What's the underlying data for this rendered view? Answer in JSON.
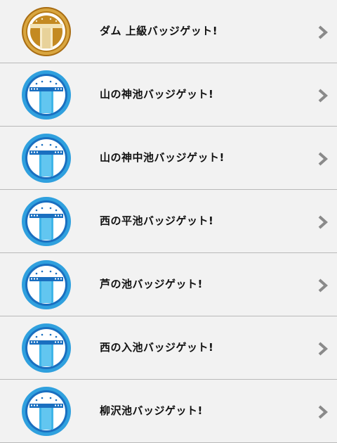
{
  "badges": [
    {
      "label": "ダム 上級バッジゲット!",
      "icon": "gold-dam-badge-icon",
      "tier": "gold"
    },
    {
      "label": "山の神池バッジゲット!",
      "icon": "blue-dam-badge-icon",
      "tier": "blue"
    },
    {
      "label": "山の神中池バッジゲット!",
      "icon": "blue-dam-badge-icon",
      "tier": "blue"
    },
    {
      "label": "西の平池バッジゲット!",
      "icon": "blue-dam-badge-icon",
      "tier": "blue"
    },
    {
      "label": "芦の池バッジゲット!",
      "icon": "blue-dam-badge-icon",
      "tier": "blue"
    },
    {
      "label": "西の入池バッジゲット!",
      "icon": "blue-dam-badge-icon",
      "tier": "blue"
    },
    {
      "label": "柳沢池バッジゲット!",
      "icon": "blue-dam-badge-icon",
      "tier": "blue"
    }
  ],
  "colors": {
    "background": "#f2f2f2",
    "divider": "#b9b9b9",
    "chevron": "#8a8a8a",
    "gold_outer": "#c8962a",
    "gold_inner": "#a56a10",
    "blue_outer": "#2fa0de",
    "blue_inner": "#1a6fc0",
    "water": "#3fb5e8"
  }
}
